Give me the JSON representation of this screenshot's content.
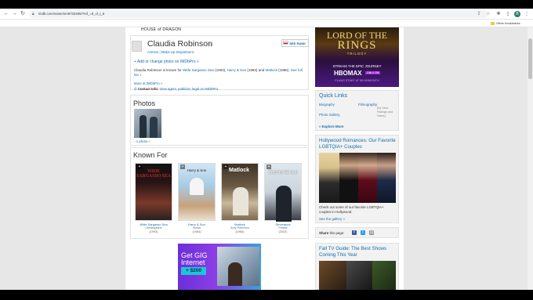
{
  "browser": {
    "url": "imdb.com/name/nm9732485/?ref_=tt_cl_t_6",
    "other_bookmarks": "Other bookmarks",
    "profile_initial": "B"
  },
  "page": {
    "house_of_dragon": "HOUSE of DRAGON",
    "person": {
      "name": "Claudia Robinson",
      "name_index": "(I)",
      "roles": "Actress | Make-Up Department",
      "see_rank": "SEE RANK"
    },
    "add_photo": "Add or change photo on IMDbPro »",
    "bio": {
      "prefix": "Claudia Robinson is known for",
      "film1": "Wide Sargasso Sea",
      "film1_year": "(1993),",
      "film2": "Harry & Son",
      "film2_year": "(1984)",
      "and": "and",
      "film3": "Matlock",
      "film3_year": "(1986).",
      "see_full": "See full bio »"
    },
    "more_at": "More at IMDbPro »",
    "contact": {
      "label": "Contact Info:",
      "links": "View agent, publicist, legal on IMDbPro"
    },
    "photos_header": "Photos",
    "photo_count": "1 photo »",
    "known_for_header": "Known For",
    "known_for": [
      {
        "title": "Wide Sargasso Sea",
        "role": "Christophine",
        "year": "(1993)",
        "poster_text": "WIDE SARGASSO SEA"
      },
      {
        "title": "Harry & Son",
        "role": "Nurse",
        "year": "(1984)",
        "poster_text": "Harry & Son"
      },
      {
        "title": "Matlock",
        "role": "Amy Peterson",
        "year": "(1986)",
        "poster_text": "Matlock"
      },
      {
        "title": "Severance",
        "role": "Felicia",
        "year": "(2022)",
        "poster_text": "Severance"
      }
    ],
    "ad": {
      "title": "Get GIG Internet",
      "badge": "+ $200"
    }
  },
  "sidebar": {
    "hbo": {
      "line1": "LORD OF THE",
      "line2": "RINGS",
      "line3": "TRILOGY",
      "stream": "STREAM THE EPIC JOURNEY",
      "logo": "HBOMAX",
      "tag": "ONLY ON",
      "date": "PLANS START AT $9.99/MONTH"
    },
    "quick_links": {
      "header": "Quick Links",
      "biography": "Biography",
      "filmography": "Filmography",
      "filmography_sub": "(by Year, Ratings and Votes)",
      "photo_gallery": "Photo Gallery",
      "explore": "Explore More"
    },
    "hollywood": {
      "title": "Hollywood Romances: Our Favorite LGBTQIA+ Couples",
      "desc": "Check out some of our favorite LGBTQIA+ couples in Hollywood.",
      "gallery": "See the gallery »"
    },
    "share": {
      "label": "Share",
      "suffix": "this page:"
    },
    "fall_tv": {
      "title": "Fall TV Guide: The Best Shows Coming This Year"
    }
  }
}
